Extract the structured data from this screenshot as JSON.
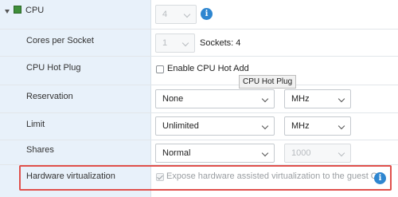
{
  "cpu": {
    "label": "CPU",
    "expanded": true,
    "value": "4"
  },
  "cores_per_socket": {
    "label": "Cores per Socket",
    "value": "1",
    "sockets_text": "Sockets: 4"
  },
  "cpu_hot_plug": {
    "label": "CPU Hot Plug",
    "checkbox_label": "Enable CPU Hot Add",
    "checked": false,
    "tooltip": "CPU Hot Plug"
  },
  "reservation": {
    "label": "Reservation",
    "value": "None",
    "unit": "MHz"
  },
  "limit": {
    "label": "Limit",
    "value": "Unlimited",
    "unit": "MHz"
  },
  "shares": {
    "label": "Shares",
    "value": "Normal",
    "amount": "1000"
  },
  "hardware_virtualization": {
    "label": "Hardware virtualization",
    "checkbox_label": "Expose hardware assisted virtualization to the guest OS",
    "checked": true,
    "highlighted": true
  },
  "colors": {
    "label_bg": "#e8f1fa",
    "info_blue": "#2e86d0",
    "highlight_red": "#e0504c",
    "cpu_icon_green": "#3f8f3a"
  }
}
